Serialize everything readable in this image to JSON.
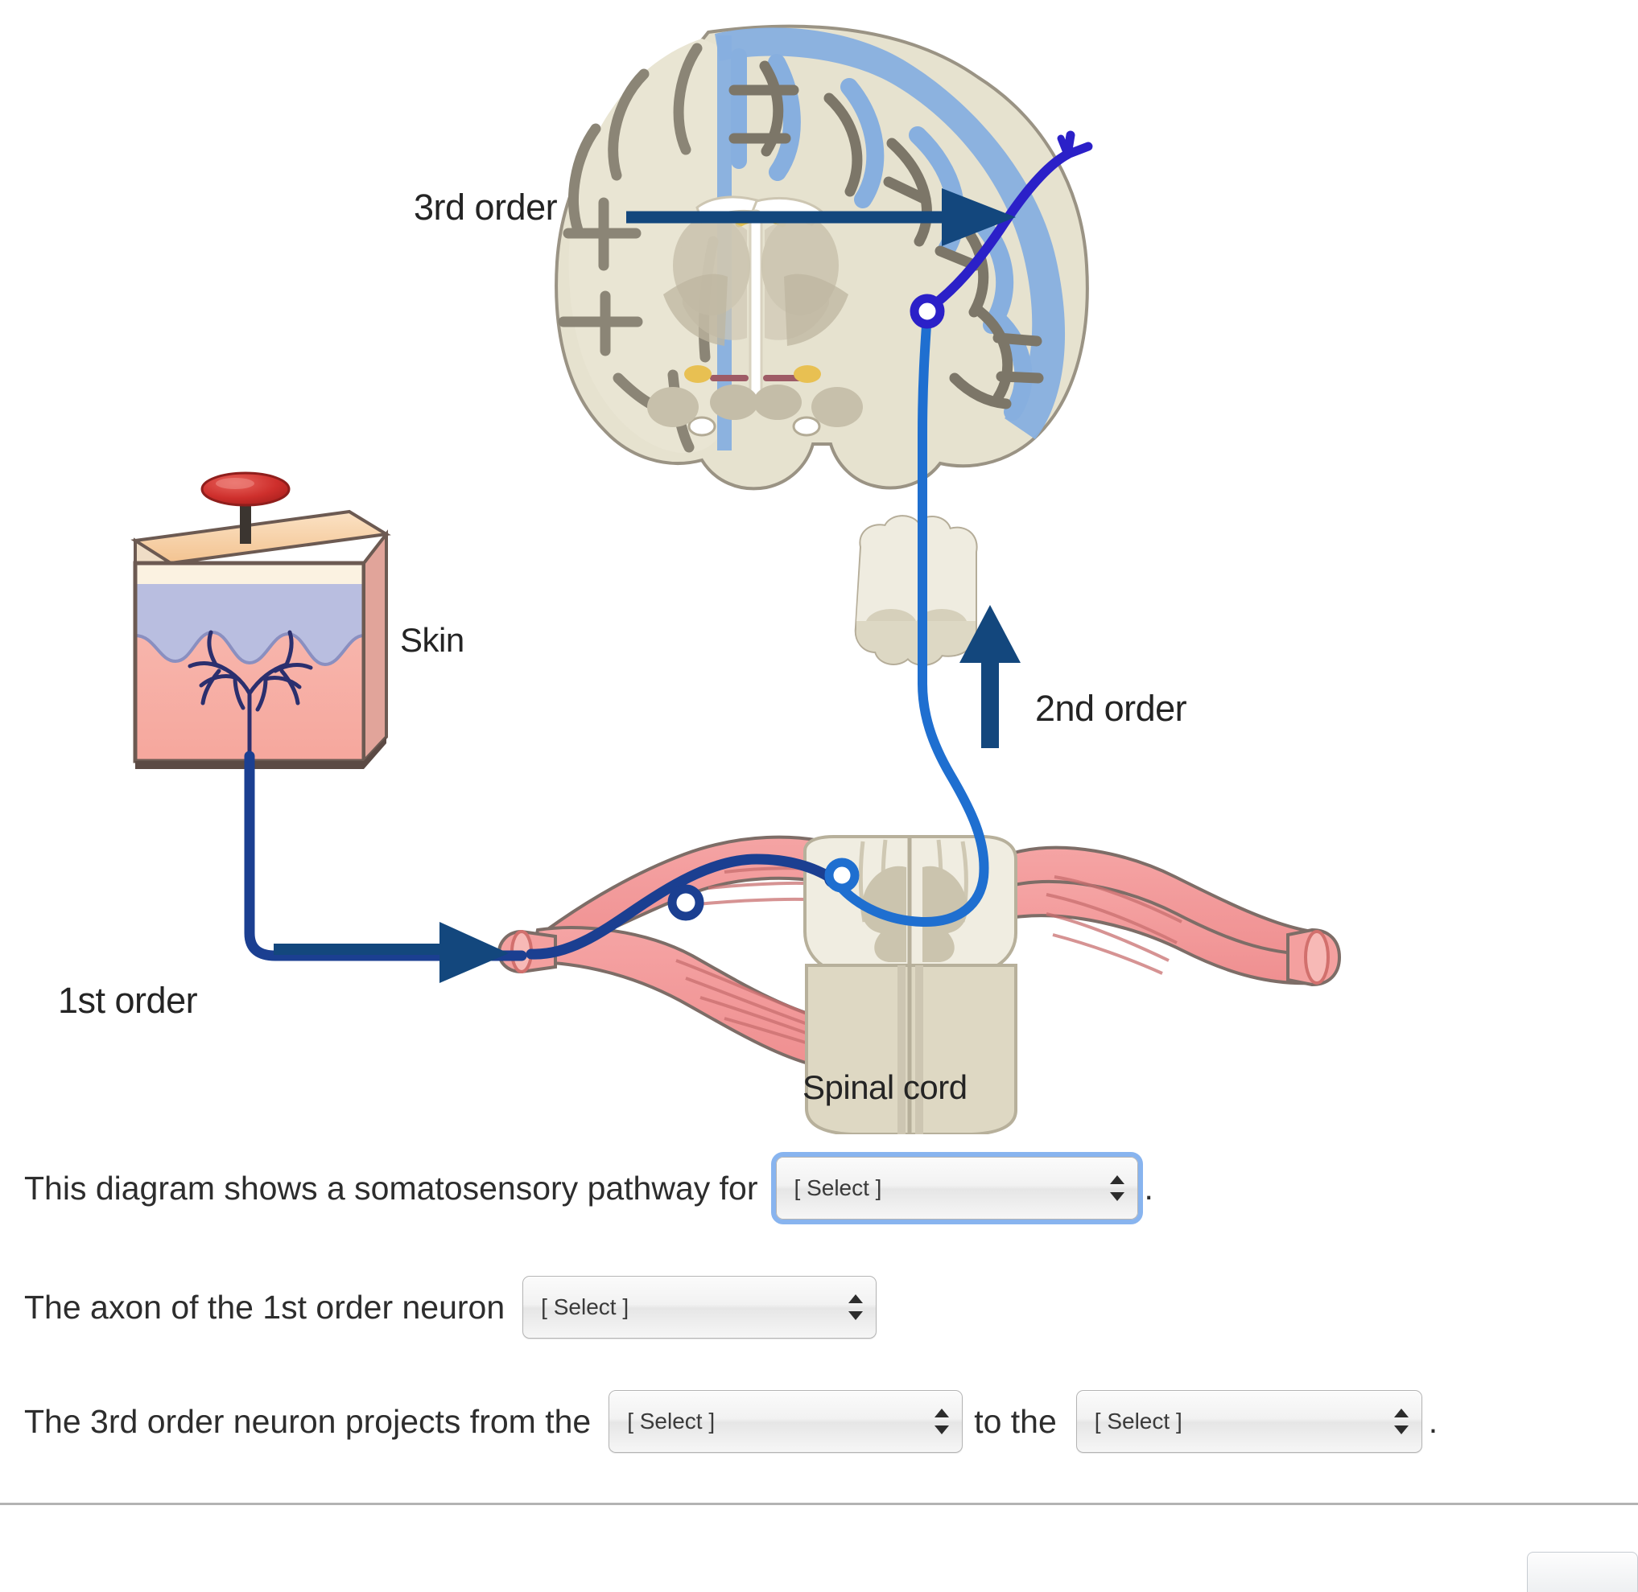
{
  "figure": {
    "labels": {
      "third_order": "3rd order",
      "second_order": "2nd order",
      "first_order": "1st order",
      "skin": "Skin",
      "spinal_cord": "Spinal cord"
    },
    "colors": {
      "arrow_dark_blue": "#13477d",
      "first_order_neuron": "#1b3f91",
      "second_order_neuron": "#1f6fd0",
      "third_order_neuron": "#2b20c8",
      "cortex_highlight": "#7fa9dd",
      "brain_tissue": "#e4e0cd",
      "brain_outline": "#8c8677",
      "nerve_pink": "#f3969a",
      "skin_dermis": "#f6b6ad",
      "skin_epidermis": "#b9bee0",
      "skin_surface": "#f6d3ad",
      "receptor_red": "#d0322e"
    }
  },
  "questions": [
    {
      "id": "q1",
      "lead": "This diagram shows a somatosensory pathway for",
      "select_value": "[ Select ]",
      "focused": true,
      "trailing": "."
    },
    {
      "id": "q2",
      "lead": "The axon of the 1st order neuron",
      "select_value": "[ Select ]",
      "focused": false,
      "trailing": ""
    },
    {
      "id": "q3",
      "lead": "The 3rd order neuron projects from the",
      "select_value": "[ Select ]",
      "mid": "to the",
      "select_value_2": "[ Select ]",
      "focused": false,
      "trailing": "."
    }
  ]
}
